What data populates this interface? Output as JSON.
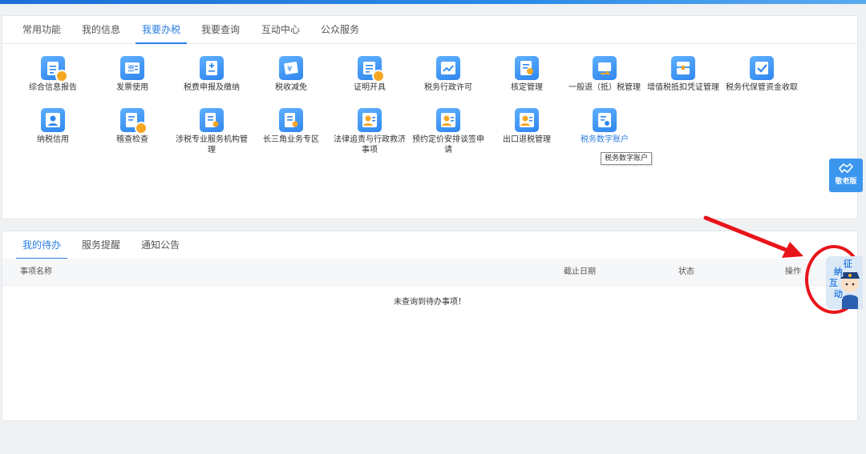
{
  "tabs_top": [
    {
      "label": "常用功能"
    },
    {
      "label": "我的信息"
    },
    {
      "label": "我要办税"
    },
    {
      "label": "我要查询"
    },
    {
      "label": "互动中心"
    },
    {
      "label": "公众服务"
    }
  ],
  "active_top_tab": "我要办税",
  "functions": [
    {
      "label": "综合信息报告",
      "icon": "report-icon"
    },
    {
      "label": "发票使用",
      "icon": "invoice-icon"
    },
    {
      "label": "税费申报及缴纳",
      "icon": "tax-declare-icon"
    },
    {
      "label": "税收减免",
      "icon": "tax-relief-icon"
    },
    {
      "label": "证明开具",
      "icon": "certificate-icon"
    },
    {
      "label": "税务行政许可",
      "icon": "admin-permit-icon"
    },
    {
      "label": "核定管理",
      "icon": "assessment-icon"
    },
    {
      "label": "一般退（抵）税管理",
      "icon": "refund-icon"
    },
    {
      "label": "增值税抵扣凭证管理",
      "icon": "vat-deduction-icon"
    },
    {
      "label": "税务代保管资金收取",
      "icon": "custody-fund-icon"
    },
    {
      "label": "纳税信用",
      "icon": "credit-icon"
    },
    {
      "label": "稽查检查",
      "icon": "inspection-icon"
    },
    {
      "label": "涉税专业服务机构管理",
      "icon": "agency-icon"
    },
    {
      "label": "长三角业务专区",
      "icon": "yangtze-zone-icon"
    },
    {
      "label": "法律追责与行政救济事项",
      "icon": "legal-icon"
    },
    {
      "label": "预约定价安排谈签申请",
      "icon": "pricing-icon"
    },
    {
      "label": "出口退税管理",
      "icon": "export-refund-icon"
    },
    {
      "label": "税务数字账户",
      "icon": "digital-account-icon"
    }
  ],
  "tooltip": "税务数字账户",
  "elder_mode_label": "敬老版",
  "tabs_bottom": [
    {
      "label": "我的待办"
    },
    {
      "label": "服务提醒"
    },
    {
      "label": "通知公告"
    }
  ],
  "active_bottom_tab": "我的待办",
  "table": {
    "columns": [
      "事项名称",
      "截止日期",
      "状态",
      "操作"
    ],
    "empty_text": "未查询到待办事项！"
  },
  "mascot": {
    "text_1": "征",
    "text_2": "纳",
    "text_3": "互",
    "text_4": "动"
  },
  "colors": {
    "accent": "#2a7de1",
    "icon_blue": "#3b8ff0",
    "annotation_red": "#e8141a"
  }
}
